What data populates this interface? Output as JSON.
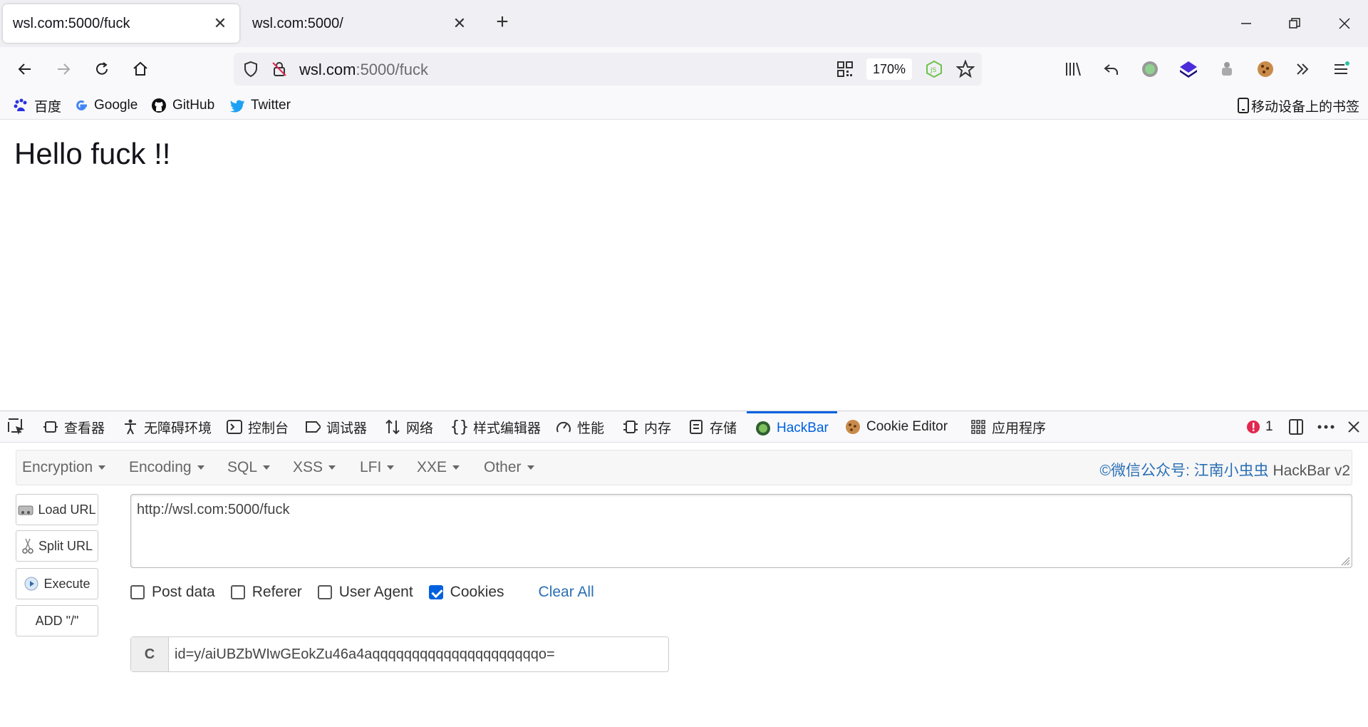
{
  "tabs": [
    {
      "title": "wsl.com:5000/fuck",
      "active": true
    },
    {
      "title": "wsl.com:5000/",
      "active": false
    }
  ],
  "nav": {
    "url_host": "wsl.com",
    "url_rest": ":5000/fuck",
    "zoom": "170%"
  },
  "bookmarks": [
    {
      "label": "百度",
      "icon": "baidu-icon"
    },
    {
      "label": "Google",
      "icon": "google-icon"
    },
    {
      "label": "GitHub",
      "icon": "github-icon"
    },
    {
      "label": "Twitter",
      "icon": "twitter-icon"
    }
  ],
  "mobile_bookmarks": "移动设备上的书签",
  "page": {
    "heading": "Hello fuck !!"
  },
  "devtools": {
    "tabs": [
      "查看器",
      "无障碍环境",
      "控制台",
      "调试器",
      "网络",
      "样式编辑器",
      "性能",
      "内存",
      "存储",
      "HackBar",
      "Cookie Editor",
      "应用程序"
    ],
    "selected": "HackBar",
    "error_count": "1"
  },
  "hackbar": {
    "menus": [
      "Encryption",
      "Encoding",
      "SQL",
      "XSS",
      "LFI",
      "XXE",
      "Other"
    ],
    "credit_link": "©微信公众号: 江南小虫虫",
    "credit_plain": " HackBar v2",
    "buttons": {
      "load": "Load URL",
      "split": "Split URL",
      "execute": "Execute",
      "add": "ADD \"/\""
    },
    "url_value": "http://wsl.com:5000/fuck",
    "checks": {
      "post": "Post data",
      "referer": "Referer",
      "ua": "User Agent",
      "cookies": "Cookies"
    },
    "clear_all": "Clear All",
    "cookie_label": "C",
    "cookie_value": "id=y/aiUBZbWIwGEokZu46a4aqqqqqqqqqqqqqqqqqqqqqo="
  },
  "colors": {
    "accent": "#0061e0",
    "link": "#2a6fb5"
  }
}
